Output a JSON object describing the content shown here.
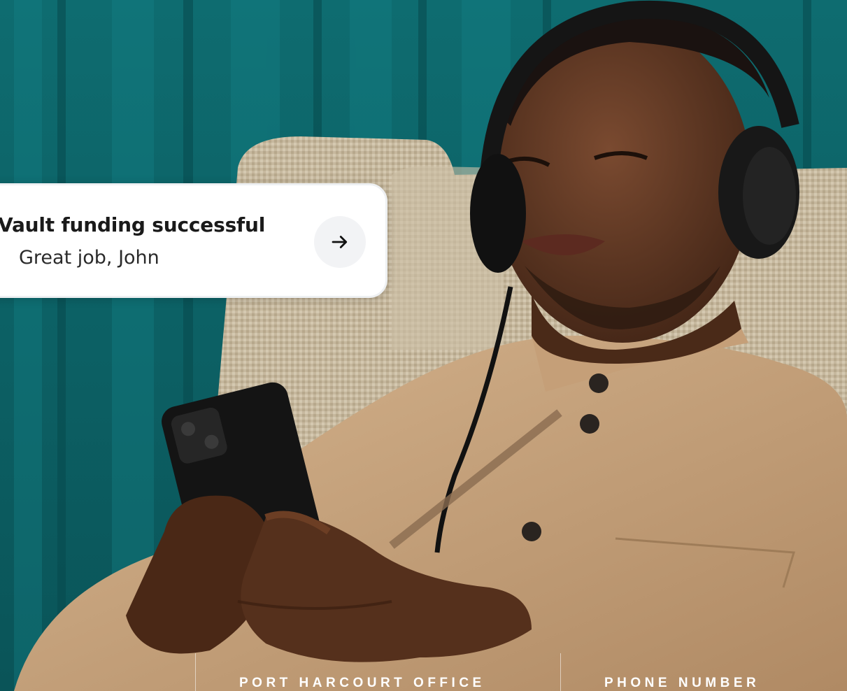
{
  "notification": {
    "title": "Vault funding successful",
    "subtitle": "Great job, John",
    "action_icon": "arrow-right-icon"
  },
  "footer": {
    "office_label": "PORT HARCOURT OFFICE",
    "phone_label": "PHONE NUMBER"
  },
  "colors": {
    "wall_teal": "#0d6a6e",
    "chair_beige": "#c2b49b",
    "shirt_tan": "#c9a37c",
    "skin": "#5a331f",
    "white": "#ffffff"
  }
}
